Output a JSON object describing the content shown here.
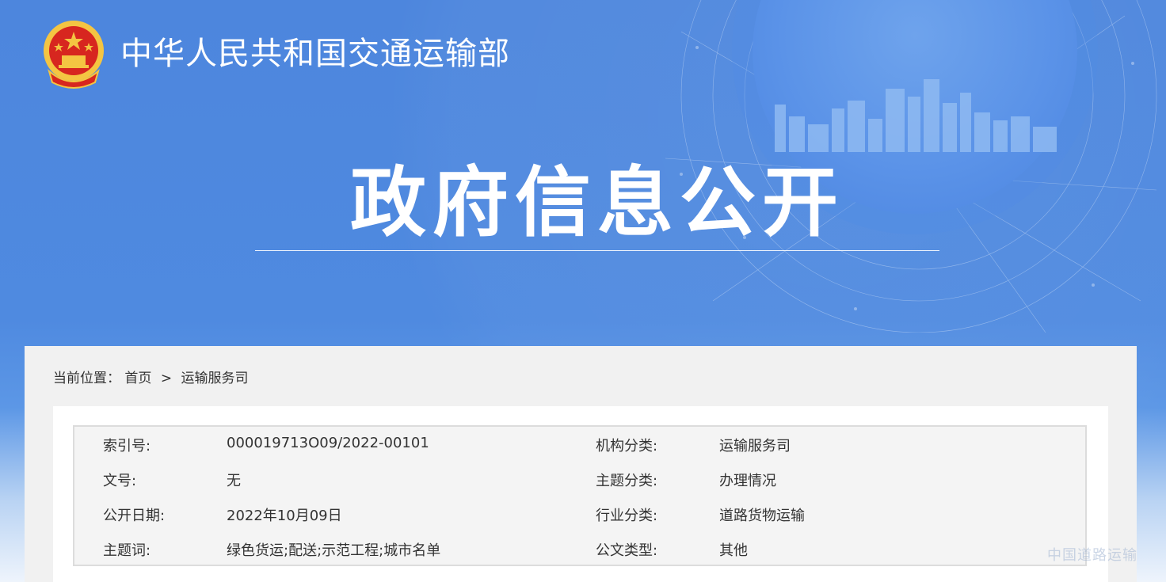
{
  "header": {
    "ministry_name": "中华人民共和国交通运输部",
    "page_title": "政府信息公开"
  },
  "breadcrumb": {
    "label": "当前位置：",
    "home": "首页",
    "separator": ">",
    "current": "运输服务司"
  },
  "meta": {
    "rows": [
      {
        "k1": "索引号:",
        "v1": "000019713O09/2022-00101",
        "k2": "机构分类:",
        "v2": "运输服务司"
      },
      {
        "k1": "文号:",
        "v1": "无",
        "k2": "主题分类:",
        "v2": "办理情况"
      },
      {
        "k1": "公开日期:",
        "v1": "2022年10月09日",
        "k2": "行业分类:",
        "v2": "道路货物运输"
      },
      {
        "k1": "主题词:",
        "v1": "绿色货运;配送;示范工程;城市名单",
        "k2": "公文类型:",
        "v2": "其他"
      }
    ]
  },
  "watermark": "中国道路运输",
  "colors": {
    "banner_blue": "#4f8ae0",
    "emblem_red": "#d7261f",
    "emblem_gold": "#f4c542"
  }
}
